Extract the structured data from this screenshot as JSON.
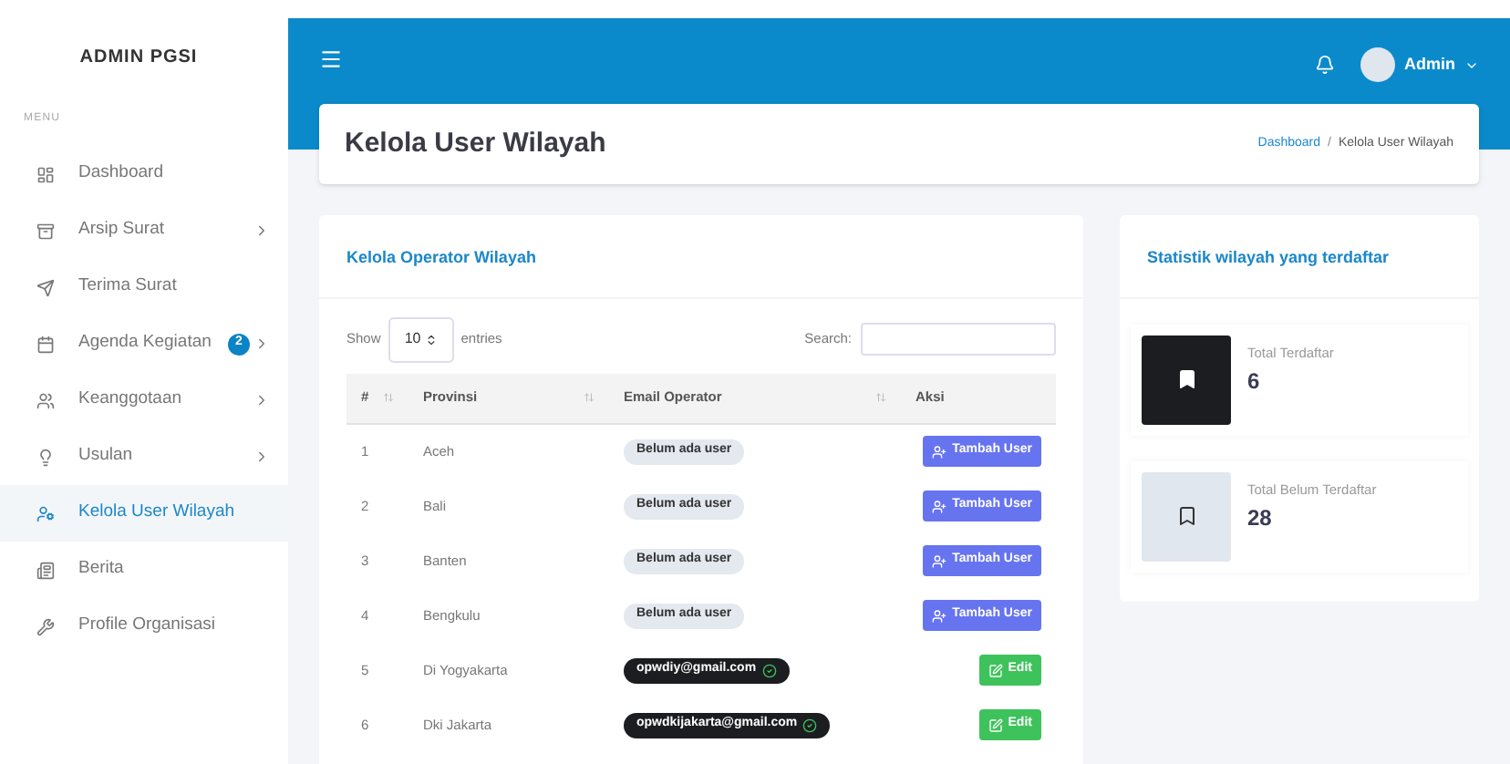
{
  "sidebar": {
    "brand": "ADMIN PGSI",
    "section": "MENU",
    "items": [
      {
        "label": "Dashboard",
        "selected": false,
        "expandable": false
      },
      {
        "label": "Arsip Surat",
        "selected": false,
        "expandable": true
      },
      {
        "label": "Terima Surat",
        "selected": false,
        "expandable": false
      },
      {
        "label": "Agenda Kegiatan",
        "selected": false,
        "expandable": true,
        "badge": "2"
      },
      {
        "label": "Keanggotaan",
        "selected": false,
        "expandable": true
      },
      {
        "label": "Usulan",
        "selected": false,
        "expandable": true
      },
      {
        "label": "Kelola User Wilayah",
        "selected": true,
        "expandable": false
      },
      {
        "label": "Berita",
        "selected": false,
        "expandable": false
      },
      {
        "label": "Profile Organisasi",
        "selected": false,
        "expandable": false
      }
    ]
  },
  "topbar": {
    "user": "Admin"
  },
  "page_header": {
    "title": "Kelola User Wilayah",
    "breadcrumb": [
      {
        "label": "Dashboard",
        "kind": "link"
      },
      {
        "label": "Kelola User Wilayah",
        "kind": "current"
      }
    ],
    "separator": "/"
  },
  "operators_card": {
    "title": "Kelola Operator Wilayah",
    "show_label": "Show",
    "page_size": "10",
    "entries_label": "entries",
    "search_label": "Search:",
    "columns": [
      "#",
      "Provinsi",
      "Email Operator",
      "Aksi"
    ],
    "rows": [
      {
        "no": "1",
        "province": "Aceh",
        "operator": {
          "kind": "empty",
          "text": "Belum ada user"
        },
        "action": {
          "kind": "add",
          "label": "Tambah User"
        }
      },
      {
        "no": "2",
        "province": "Bali",
        "operator": {
          "kind": "empty",
          "text": "Belum ada user"
        },
        "action": {
          "kind": "add",
          "label": "Tambah User"
        }
      },
      {
        "no": "3",
        "province": "Banten",
        "operator": {
          "kind": "empty",
          "text": "Belum ada user"
        },
        "action": {
          "kind": "add",
          "label": "Tambah User"
        }
      },
      {
        "no": "4",
        "province": "Bengkulu",
        "operator": {
          "kind": "empty",
          "text": "Belum ada user"
        },
        "action": {
          "kind": "add",
          "label": "Tambah User"
        }
      },
      {
        "no": "5",
        "province": "Di Yogyakarta",
        "operator": {
          "kind": "email",
          "text": "opwdiy@gmail.com"
        },
        "action": {
          "kind": "edit",
          "label": "Edit"
        }
      },
      {
        "no": "6",
        "province": "Dki Jakarta",
        "operator": {
          "kind": "email",
          "text": "opwdkijakarta@gmail.com"
        },
        "action": {
          "kind": "edit",
          "label": "Edit"
        }
      }
    ]
  },
  "stats_card": {
    "title": "Statistik wilayah yang terdaftar",
    "items": [
      {
        "label": "Total Terdaftar",
        "value": "6",
        "kind": "filled"
      },
      {
        "label": "Total Belum Terdaftar",
        "value": "28",
        "kind": "outline"
      }
    ]
  }
}
